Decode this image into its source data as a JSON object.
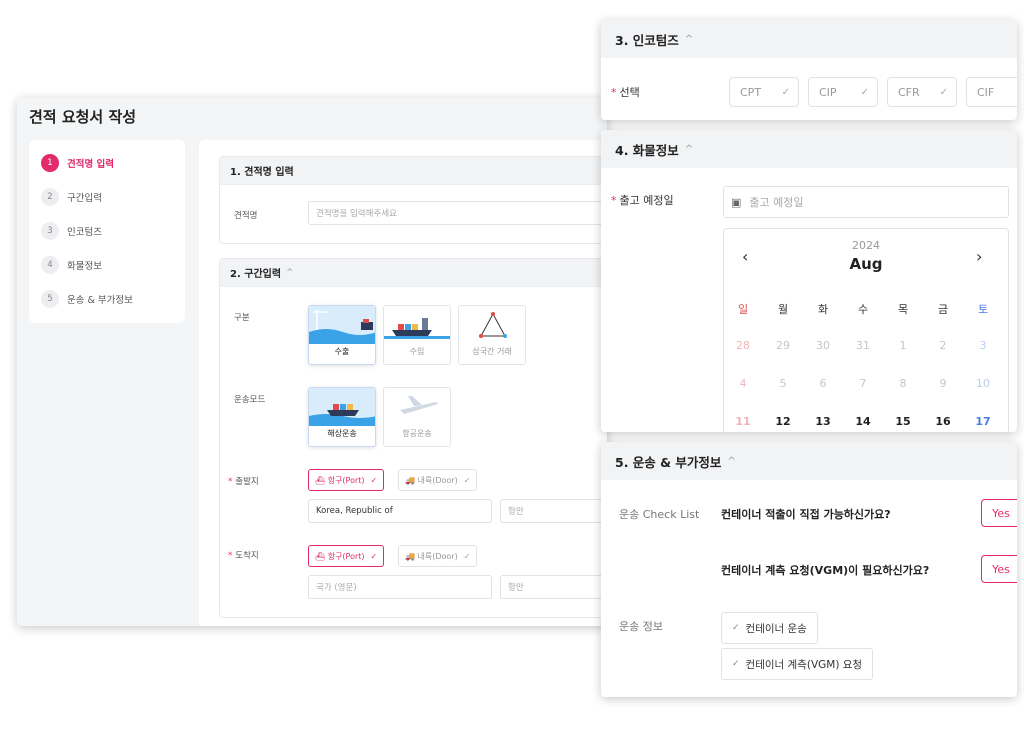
{
  "main": {
    "title": "견적 요청서 작성",
    "steps": [
      {
        "num": "1",
        "label": "견적명 입력"
      },
      {
        "num": "2",
        "label": "구간입력"
      },
      {
        "num": "3",
        "label": "인코텀즈"
      },
      {
        "num": "4",
        "label": "화물정보"
      },
      {
        "num": "5",
        "label": "운송 & 부가정보"
      }
    ],
    "section1": {
      "title": "1. 견적명 입력",
      "field_label": "견적명",
      "placeholder": "견적명을 입력해주세요"
    },
    "section2": {
      "title": "2. 구간입력",
      "type_label": "구분",
      "types": [
        "수출",
        "수입",
        "삼국간 거래"
      ],
      "mode_label": "운송모드",
      "modes": [
        "해상운송",
        "항공운송"
      ],
      "origin_label": "출발지",
      "origin_port": "항구(Port)",
      "origin_door": "내륙(Door)",
      "origin_country": "Korea, Republic of",
      "origin_port_placeholder": "항만",
      "dest_label": "도착지",
      "dest_port": "항구(Port)",
      "dest_door": "내륙(Door)",
      "dest_country_placeholder": "국가 (영문)",
      "dest_port_placeholder": "항만"
    }
  },
  "incoterms": {
    "title": "3. 인코텀즈",
    "label": "선택",
    "options": [
      "CPT",
      "CIP",
      "CFR",
      "CIF"
    ]
  },
  "cargo": {
    "title": "4. 화물정보",
    "date_label": "출고 예정일",
    "date_placeholder": "출고 예정일",
    "calendar": {
      "year": "2024",
      "month": "Aug",
      "prev": "‹",
      "next": "›",
      "weekdays": [
        "일",
        "월",
        "화",
        "수",
        "목",
        "금",
        "토"
      ],
      "rows": [
        [
          "28",
          "29",
          "30",
          "31",
          "1",
          "2",
          "3"
        ],
        [
          "4",
          "5",
          "6",
          "7",
          "8",
          "9",
          "10"
        ],
        [
          "11",
          "12",
          "13",
          "14",
          "15",
          "16",
          "17"
        ]
      ]
    }
  },
  "transport": {
    "title": "5. 운송 & 부가정보",
    "checklist_label": "운송 Check List",
    "q1": "컨테이너 적출이 직접 가능하신가요?",
    "q2": "컨테이너 계측 요청(VGM)이 필요하신가요?",
    "yes": "Yes",
    "info_label": "운송 정보",
    "services": [
      "컨테이너 운송",
      "컨테이너 계측(VGM) 요청"
    ]
  },
  "colors": {
    "accent": "#e32a6d",
    "sunday": "#e24a4a",
    "saturday": "#4a7de2"
  }
}
